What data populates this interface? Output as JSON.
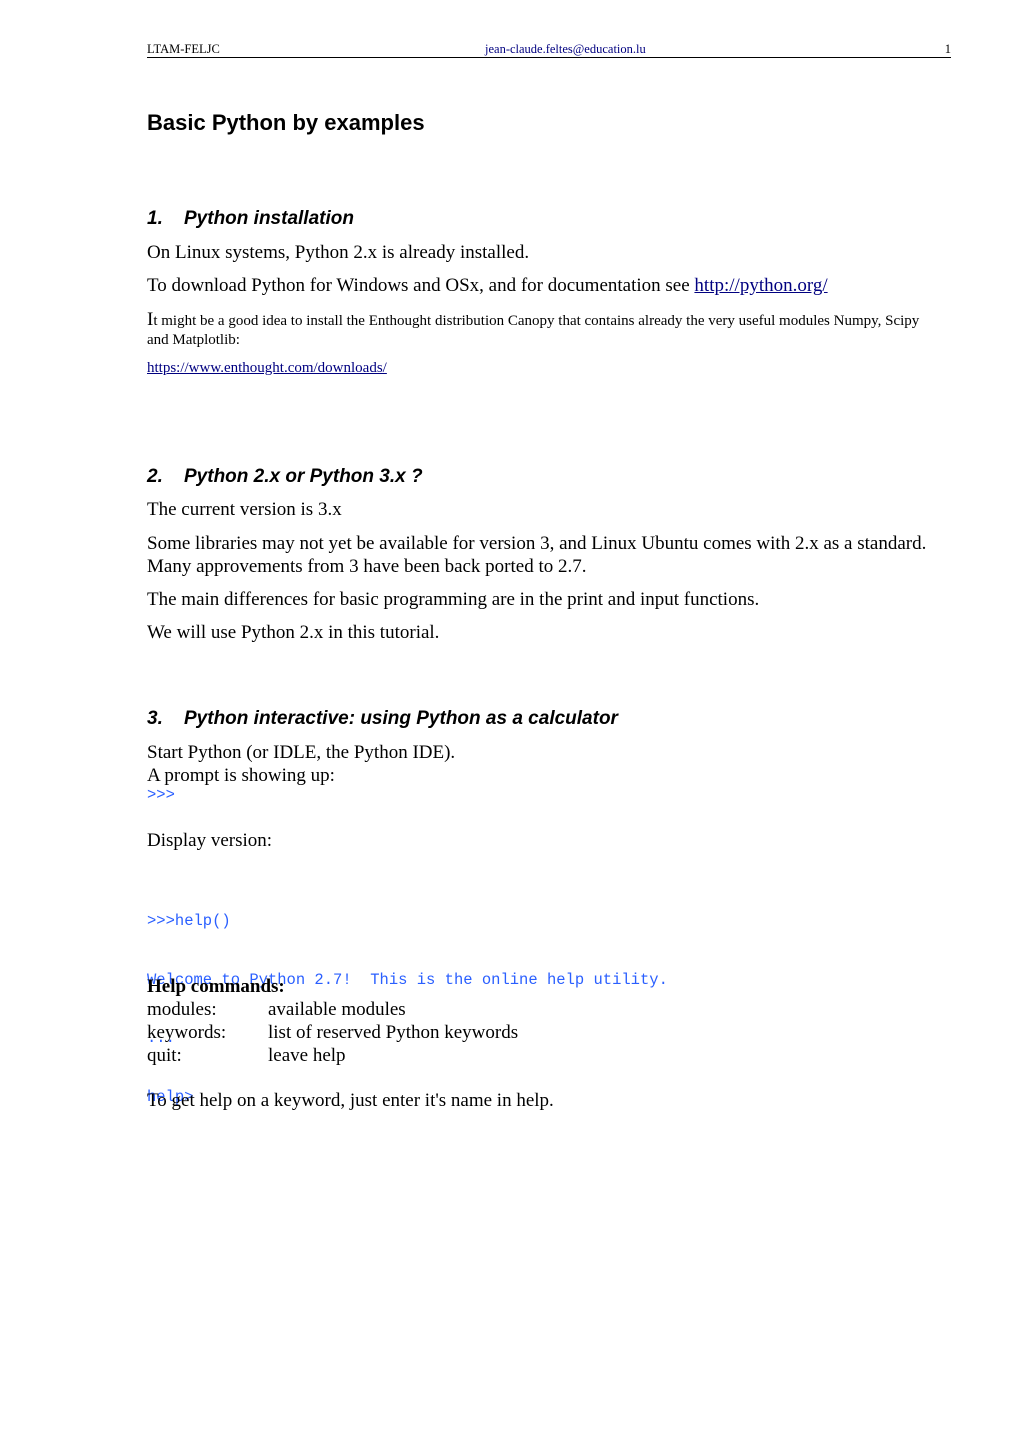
{
  "header": {
    "left": "LTAM-FELJC",
    "center": "jean-claude.feltes@education.lu",
    "right": "1"
  },
  "title": "Basic Python by examples",
  "sections": [
    {
      "number": "1.",
      "heading": "Python installation",
      "para1": "On Linux systems, Python 2.x is already installed.",
      "para2_text": "To download Python for Windows and OSx, and for documentation see ",
      "para2_link": "http://python.org/",
      "para3_first": "I",
      "para3_rest": "t might be a good idea to install the Enthought distribution Canopy that contains already   the very useful modules Numpy, Scipy and Matplotlib:",
      "para4_link": "https://www.enthought.com/downloads/"
    },
    {
      "number": "2.",
      "heading": "Python 2.x or Python 3.x ?",
      "para1": "The current version is 3.x",
      "para2": "Some libraries may not yet be available for version 3, and Linux Ubuntu comes with 2.x as a standard. Many approvements from 3 have been back ported to 2.7.",
      "para3": "The main differences for basic programming are in the print and input functions.",
      "para4": "We will use Python 2.x in this tutorial."
    },
    {
      "number": "3.",
      "heading": "Python interactive: using Python as a calculator",
      "para1": "Start Python (or IDLE, the Python IDE).",
      "para2": "A prompt is showing up:",
      "prompt": ">>>",
      "para3": "Display version:",
      "code_lines": [
        ">>>help()",
        "Welcome to Python 2.7!  This is the online help utility.",
        "...",
        "help>"
      ],
      "help_title": "Help commands:",
      "help_commands": [
        {
          "key": "modules:",
          "desc": "available modules"
        },
        {
          "key": "keywords:",
          "desc": "list of reserved Python keywords"
        },
        {
          "key": "quit:",
          "desc": "leave help"
        }
      ],
      "para4": "To get help on a keyword, just enter it's name in help."
    }
  ]
}
